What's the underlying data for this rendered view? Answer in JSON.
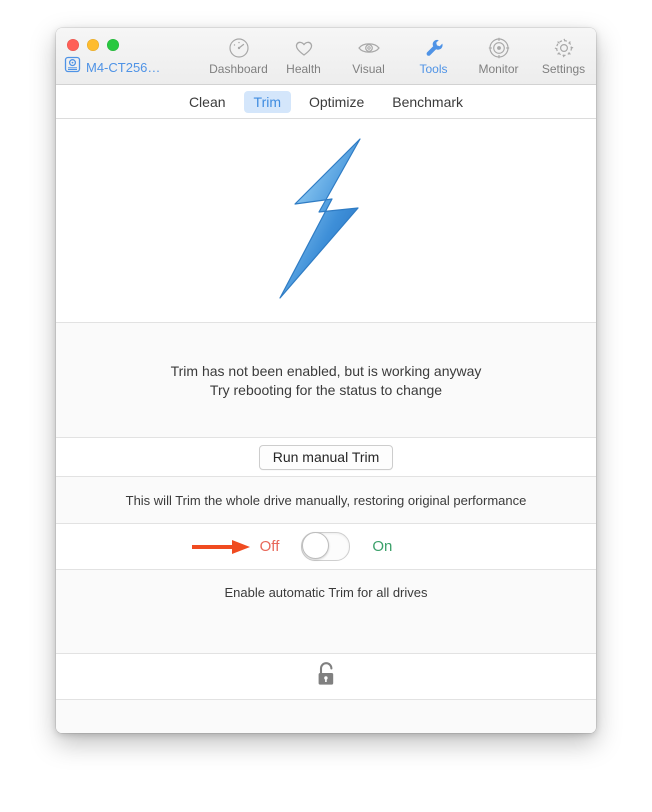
{
  "window": {
    "traffic_lights": [
      {
        "name": "close",
        "color": "#ff5f57"
      },
      {
        "name": "minimize",
        "color": "#febc2e"
      },
      {
        "name": "zoom",
        "color": "#28c840"
      }
    ]
  },
  "toolbar": {
    "drive": {
      "label": "M4-CT256…",
      "icon": "hard-drive-icon",
      "color": "#4f93e6"
    },
    "items": [
      {
        "label": "Dashboard",
        "icon": "gauge-icon",
        "active": false
      },
      {
        "label": "Health",
        "icon": "heart-icon",
        "active": false
      },
      {
        "label": "Visual",
        "icon": "eye-icon",
        "active": false
      },
      {
        "label": "Tools",
        "icon": "wrench-icon",
        "active": true
      },
      {
        "label": "Monitor",
        "icon": "radar-icon",
        "active": false
      },
      {
        "label": "Settings",
        "icon": "gear-icon",
        "active": false
      }
    ],
    "active_color": "#4f93e6",
    "inactive_color": "#808080"
  },
  "tabs": {
    "items": [
      {
        "label": "Clean",
        "active": false
      },
      {
        "label": "Trim",
        "active": true
      },
      {
        "label": "Optimize",
        "active": false
      },
      {
        "label": "Benchmark",
        "active": false
      }
    ],
    "active_bg": "#d4e6fb",
    "active_fg": "#3f8ce0"
  },
  "hero": {
    "icon": "lightning-bolt-icon",
    "gradient_from": "#bfe3fb",
    "gradient_to": "#1f6fc4"
  },
  "status": {
    "line1": "Trim has not been enabled, but is working anyway",
    "line2": "Try rebooting for the status to change"
  },
  "action": {
    "run_manual_trim_label": "Run manual Trim"
  },
  "hint": {
    "text": "This will Trim the whole drive manually, restoring original performance"
  },
  "toggle": {
    "off_label": "Off",
    "on_label": "On",
    "state": "off",
    "off_color": "#e8685a",
    "on_color": "#3ba06a",
    "annotation_arrow": {
      "icon": "right-arrow-annotation",
      "color": "#f04b20"
    }
  },
  "caption": {
    "text": "Enable automatic Trim for all drives"
  },
  "lockbar": {
    "icon": "unlocked-padlock-icon",
    "color": "#808080"
  }
}
